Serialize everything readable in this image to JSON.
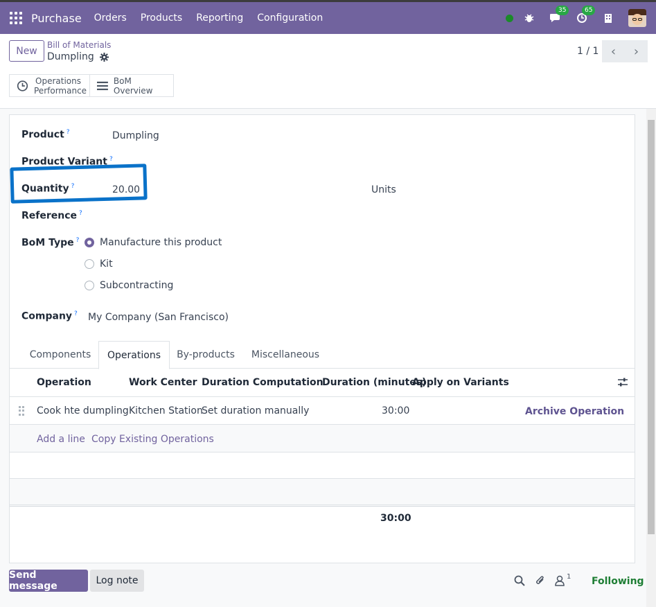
{
  "topbar": {
    "brand": "Purchase",
    "menu": [
      "Orders",
      "Products",
      "Reporting",
      "Configuration"
    ],
    "messages_count": "35",
    "activities_count": "65"
  },
  "control": {
    "new_label": "New",
    "breadcrumb": "Bill of Materials",
    "record_name": "Dumpling",
    "pager": "1 / 1",
    "smart_buttons": [
      {
        "label": "Operations Performance",
        "icon": "clock-icon"
      },
      {
        "label": "BoM Overview",
        "icon": "list-icon"
      }
    ]
  },
  "form": {
    "product_label": "Product",
    "product_value": "Dumpling",
    "variant_label": "Product Variant",
    "quantity_label": "Quantity",
    "quantity_value": "20.00",
    "uom": "Units",
    "reference_label": "Reference",
    "bom_type_label": "BoM Type",
    "bom_types": [
      "Manufacture this product",
      "Kit",
      "Subcontracting"
    ],
    "bom_type_selected": "Manufacture this product",
    "company_label": "Company",
    "company_value": "My Company (San Francisco)",
    "help_mark": "?"
  },
  "tabs": [
    "Components",
    "Operations",
    "By-products",
    "Miscellaneous"
  ],
  "active_tab": "Operations",
  "operations": {
    "columns": [
      "Operation",
      "Work Center",
      "Duration Computation",
      "Duration (minutes)",
      "Apply on Variants"
    ],
    "rows": [
      {
        "operation": "Cook hte dumpling",
        "work_center": "Kitchen Station",
        "computation": "Set duration manually",
        "duration": "30:00",
        "action": "Archive Operation"
      }
    ],
    "add_line": "Add a line",
    "copy_existing": "Copy Existing Operations",
    "total": "30:00"
  },
  "chatter": {
    "send_message": "Send message",
    "log_note": "Log note",
    "followers_count": "1",
    "following": "Following"
  },
  "colors": {
    "brand": "#71639e",
    "highlight": "#0a72c9",
    "following": "#1e7e34"
  }
}
